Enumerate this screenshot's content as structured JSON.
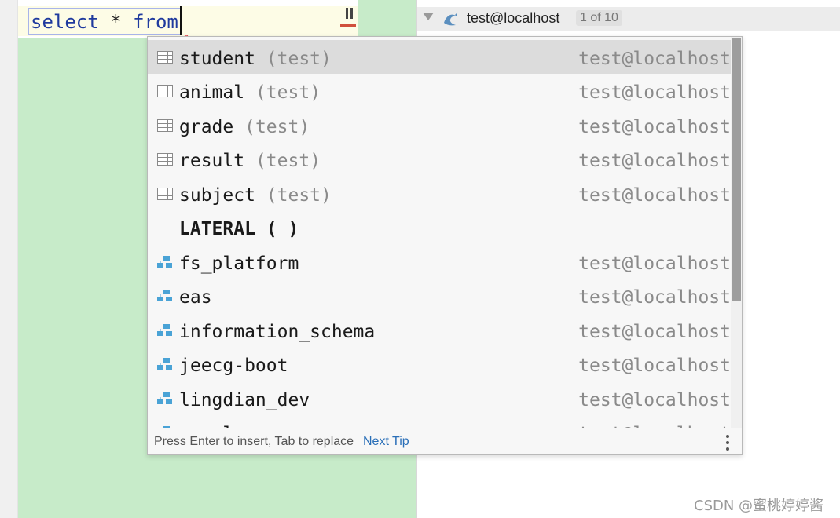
{
  "editor": {
    "code_keyword": "select",
    "code_star": "*",
    "code_from": "from"
  },
  "right_panel": {
    "connection_label": "test@localhost",
    "count_badge": "1 of 10"
  },
  "completion": {
    "items": [
      {
        "name": "student",
        "schema": "(test)",
        "conn": "test@localhost",
        "icon": "table-icon"
      },
      {
        "name": "animal",
        "schema": "(test)",
        "conn": "test@localhost",
        "icon": "table-icon"
      },
      {
        "name": "grade",
        "schema": "(test)",
        "conn": "test@localhost",
        "icon": "table-icon"
      },
      {
        "name": "result",
        "schema": "(test)",
        "conn": "test@localhost",
        "icon": "table-icon"
      },
      {
        "name": "subject",
        "schema": "(test)",
        "conn": "test@localhost",
        "icon": "table-icon"
      },
      {
        "name": "LATERAL ( )",
        "schema": "",
        "conn": "",
        "icon": ""
      },
      {
        "name": "fs_platform",
        "schema": "",
        "conn": "test@localhost",
        "icon": "schema-icon"
      },
      {
        "name": "eas",
        "schema": "",
        "conn": "test@localhost",
        "icon": "schema-icon"
      },
      {
        "name": "information_schema",
        "schema": "",
        "conn": "test@localhost",
        "icon": "schema-icon"
      },
      {
        "name": "jeecg-boot",
        "schema": "",
        "conn": "test@localhost",
        "icon": "schema-icon"
      },
      {
        "name": "lingdian_dev",
        "schema": "",
        "conn": "test@localhost",
        "icon": "schema-icon"
      },
      {
        "name": "mysql",
        "schema": "",
        "conn": "test@localhost",
        "icon": "schema-icon"
      }
    ],
    "footer_hint": "Press Enter to insert, Tab to replace",
    "footer_tip": "Next Tip"
  },
  "watermark": "CSDN @蜜桃婷婷酱",
  "colors": {
    "editor_green": "#c7ebc9",
    "keyword_blue": "#1f3a9e",
    "link_blue": "#2a6fb8",
    "schema_icon_blue": "#4aa3d6",
    "selection_gray": "#dcdcdc"
  }
}
